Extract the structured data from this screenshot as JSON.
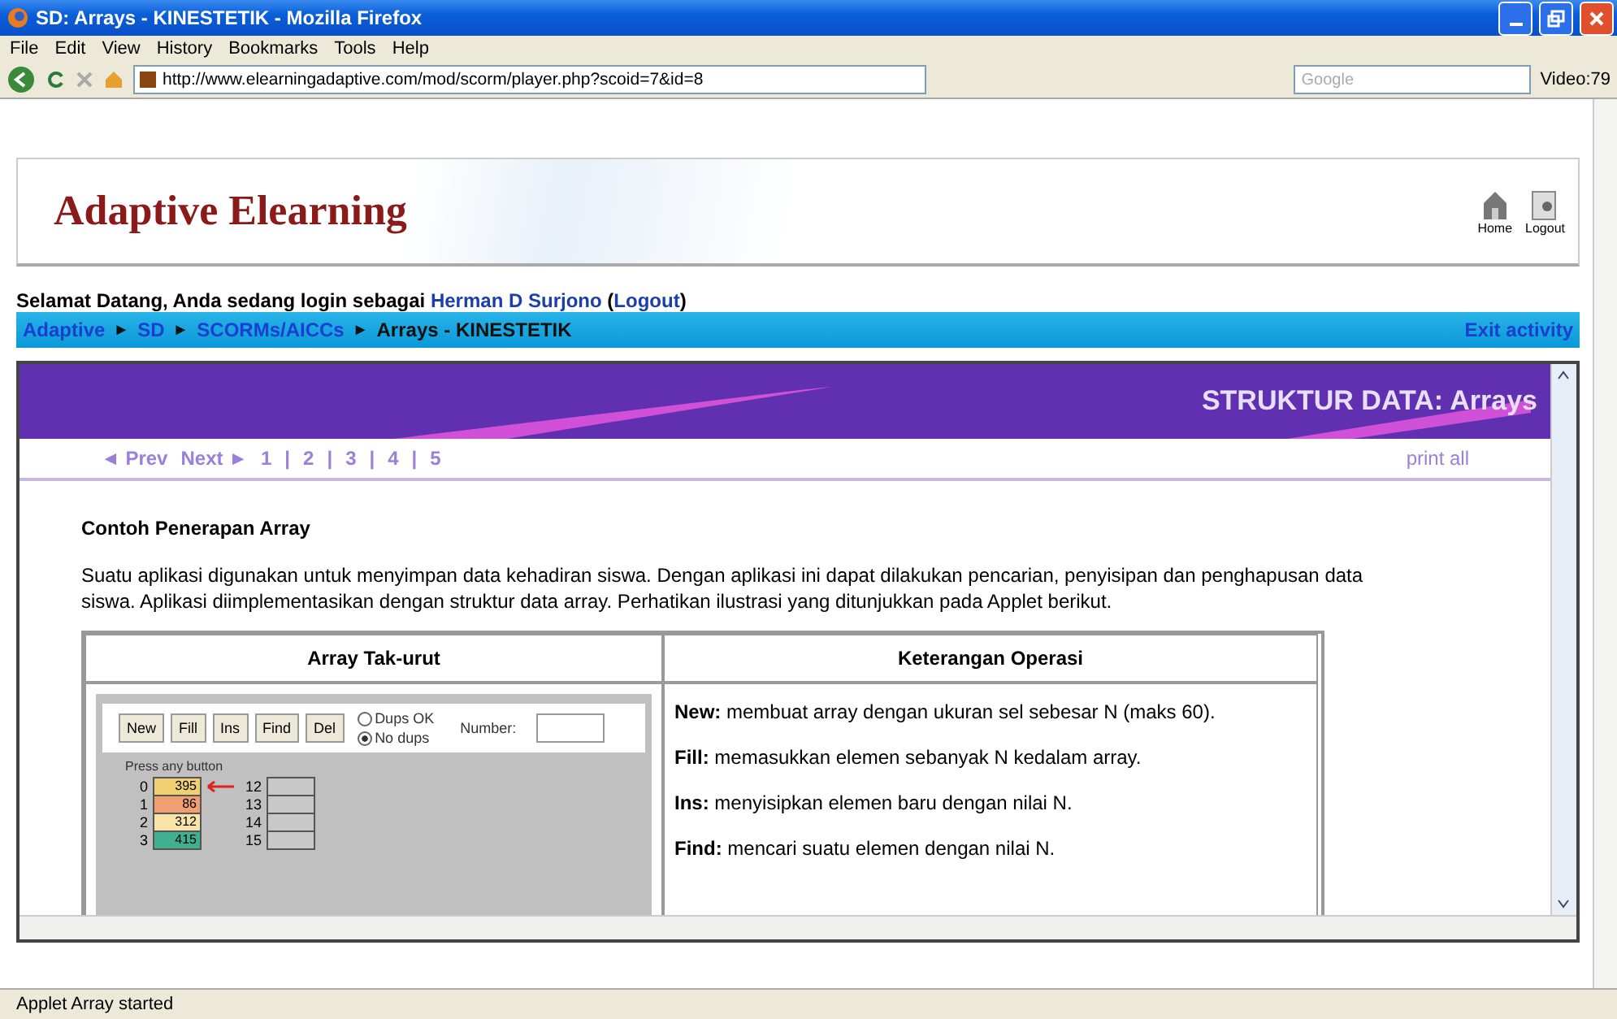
{
  "window": {
    "title": "SD: Arrays - KINESTETIK - Mozilla Firefox"
  },
  "menu": [
    "File",
    "Edit",
    "View",
    "History",
    "Bookmarks",
    "Tools",
    "Help"
  ],
  "toolbar": {
    "url": "http://www.elearningadaptive.com/mod/scorm/player.php?scoid=7&id=8",
    "search_placeholder": "Google",
    "bookmark": "Video:79"
  },
  "header": {
    "logo": "Adaptive Elearning",
    "links": [
      {
        "label": "Home",
        "kind": "home"
      },
      {
        "label": "Logout",
        "kind": "logout"
      }
    ]
  },
  "welcome": {
    "text": "Selamat Datang, Anda sedang login sebagai",
    "user": "Herman D Surjono",
    "open": "(",
    "logout": "Logout",
    "close": ")"
  },
  "breadcrumbs": [
    {
      "label": "Adaptive",
      "current": false
    },
    {
      "label": "SD",
      "current": false
    },
    {
      "label": "SCORMs/AICCs",
      "current": false
    },
    {
      "label": "Arrays - KINESTETIK",
      "current": true
    }
  ],
  "breadcrumb_separator": "►",
  "exit": "Exit activity",
  "banner": {
    "title": "STRUKTUR DATA: Arrays"
  },
  "pager": {
    "prev": "◄ Prev",
    "next": "Next ►",
    "pages": [
      "1",
      "2",
      "3",
      "4",
      "5"
    ],
    "separator": "|",
    "print": "print all"
  },
  "content": {
    "heading": "Contoh Penerapan Array",
    "paragraph": "Suatu aplikasi digunakan untuk menyimpan data kehadiran siswa. Dengan aplikasi ini dapat dilakukan pencarian, penyisipan dan penghapusan data siswa. Aplikasi diimplementasikan dengan struktur data array. Perhatikan ilustrasi yang ditunjukkan pada Applet berikut."
  },
  "table": {
    "columns": [
      "Array Tak-urut",
      "Keterangan Operasi"
    ],
    "applet": {
      "buttons": [
        "New",
        "Fill",
        "Ins",
        "Find",
        "Del"
      ],
      "radios": [
        {
          "label": "Dups OK",
          "selected": false
        },
        {
          "label": "No dups",
          "selected": true
        }
      ],
      "number_label": "Number:",
      "status": "Press any button",
      "cells": [
        {
          "index": "0",
          "value": "395",
          "color": "#f0d070",
          "pointer": true
        },
        {
          "index": "1",
          "value": "86",
          "color": "#f0a070",
          "pointer": false
        },
        {
          "index": "2",
          "value": "312",
          "color": "#f8e4a8",
          "pointer": false
        },
        {
          "index": "3",
          "value": "415",
          "color": "#40b090",
          "pointer": false
        }
      ],
      "empty_cells": [
        "12",
        "13",
        "14",
        "15"
      ]
    },
    "operations": [
      "**New:** membuat array dengan ukuran sel sebesar N (maks 60).",
      "**Fill:** memasukkan elemen sebanyak N kedalam array.",
      "**Ins:** menyisipkan elemen baru dengan nilai N.",
      "**Find:** mencari suatu elemen dengan nilai N."
    ]
  },
  "status_bar": "Applet Array started"
}
